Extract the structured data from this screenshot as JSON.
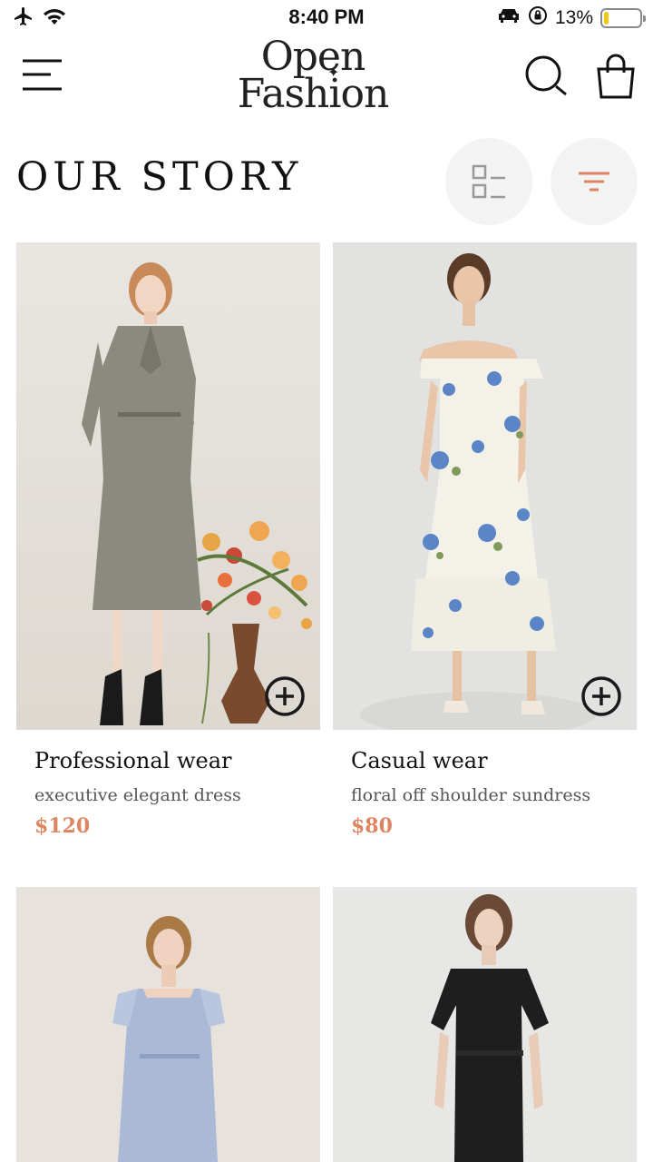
{
  "status": {
    "time": "8:40 PM",
    "battery_percent": "13%",
    "battery_level": 0.13,
    "icons": [
      "airplane-icon",
      "wifi-icon",
      "car-icon",
      "orientation-lock-icon",
      "battery-icon"
    ]
  },
  "header": {
    "logo_line1": "Open",
    "logo_line2": "Fashion",
    "icons": [
      "menu-icon",
      "search-icon",
      "shopping-bag-icon"
    ]
  },
  "page": {
    "title": "OUR STORY",
    "view_icon": "list-view-icon",
    "filter_icon": "filter-icon"
  },
  "colors": {
    "accent": "#dd8560",
    "button_bg": "#f3f3f3",
    "text": "#111111",
    "muted": "#555555"
  },
  "products": [
    {
      "title": "Professional wear",
      "description": "executive elegant dress",
      "price": "$120"
    },
    {
      "title": "Casual wear",
      "description": "floral off shoulder sundress",
      "price": "$80"
    },
    {
      "title": "",
      "description": "",
      "price": ""
    },
    {
      "title": "",
      "description": "",
      "price": ""
    }
  ]
}
